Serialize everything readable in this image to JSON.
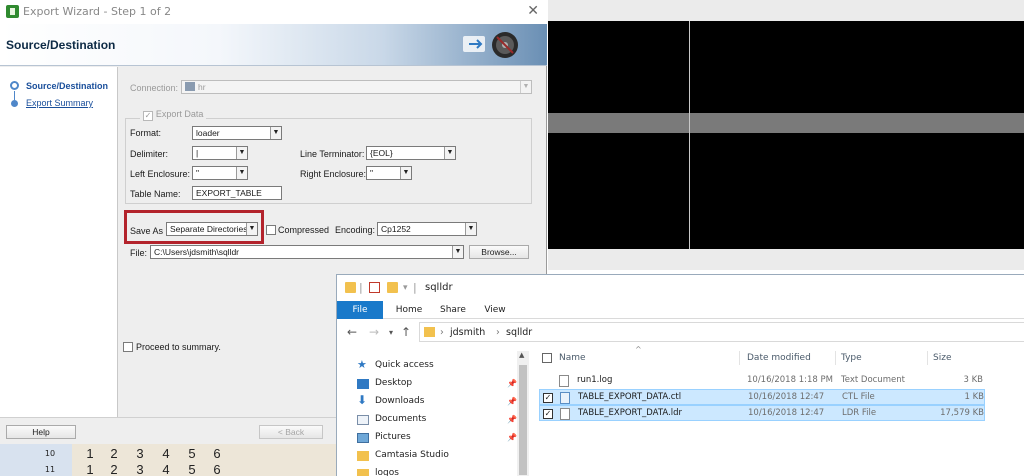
{
  "wizard": {
    "title": "Export Wizard - Step 1 of 2",
    "heading": "Source/Destination",
    "steps": [
      "Source/Destination",
      "Export Summary"
    ],
    "connection_label": "Connection:",
    "connection_value": "hr",
    "export_data_label": "Export Data",
    "format_label": "Format:",
    "format_value": "loader",
    "delimiter_label": "Delimiter:",
    "delimiter_value": "|",
    "line_terminator_label": "Line Terminator:",
    "line_terminator_value": "{EOL}",
    "left_enclosure_label": "Left Enclosure:",
    "left_enclosure_value": "\"",
    "right_enclosure_label": "Right Enclosure:",
    "right_enclosure_value": "\"",
    "table_name_label": "Table Name:",
    "table_name_value": "EXPORT_TABLE",
    "save_as_label": "Save As",
    "save_as_value": "Separate Directories",
    "compressed_label": "Compressed",
    "encoding_label": "Encoding:",
    "encoding_value": "Cp1252",
    "file_label": "File:",
    "file_value": "C:\\Users\\jdsmith\\sqlldr",
    "browse_label": "Browse...",
    "proceed_label": "Proceed to summary.",
    "help_label": "Help",
    "back_label": "< Back",
    "colors": {
      "highlight": "#b3232c",
      "step_link": "#1a4f9b"
    }
  },
  "sheet": {
    "rows": [
      {
        "num": "10",
        "cells": [
          "1",
          "2",
          "3",
          "4",
          "5",
          "6"
        ]
      },
      {
        "num": "11",
        "cells": [
          "1",
          "2",
          "3",
          "4",
          "5",
          "6"
        ]
      }
    ]
  },
  "explorer": {
    "title": "sqlldr",
    "tabs": [
      "File",
      "Home",
      "Share",
      "View"
    ],
    "breadcrumb": [
      "jdsmith",
      "sqlldr"
    ],
    "nav_items": [
      {
        "label": "Quick access",
        "icon": "star-icon"
      },
      {
        "label": "Desktop",
        "icon": "desktop-icon"
      },
      {
        "label": "Downloads",
        "icon": "download-icon"
      },
      {
        "label": "Documents",
        "icon": "documents-icon"
      },
      {
        "label": "Pictures",
        "icon": "pictures-icon"
      },
      {
        "label": "Camtasia Studio",
        "icon": "folder-icon"
      },
      {
        "label": "logos",
        "icon": "folder-icon"
      }
    ],
    "columns": [
      "Name",
      "Date modified",
      "Type",
      "Size"
    ],
    "files": [
      {
        "name": "run1.log",
        "date": "10/16/2018 1:18 PM",
        "type": "Text Document",
        "size": "3 KB",
        "selected": false
      },
      {
        "name": "TABLE_EXPORT_DATA.ctl",
        "date": "10/16/2018 12:47",
        "type": "CTL File",
        "size": "1 KB",
        "selected": true
      },
      {
        "name": "TABLE_EXPORT_DATA.ldr",
        "date": "10/16/2018 12:47",
        "type": "LDR File",
        "size": "17,579 KB",
        "selected": true
      }
    ],
    "colors": {
      "file_tab": "#1979ca",
      "selection": "#cce8ff"
    }
  }
}
